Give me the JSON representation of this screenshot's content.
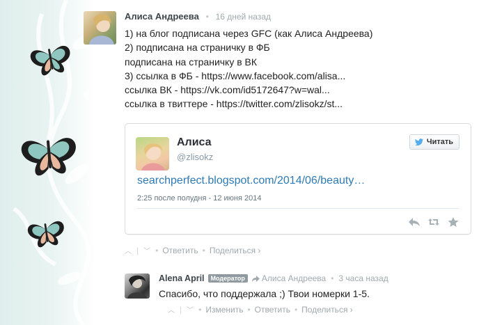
{
  "comments": [
    {
      "author": "Алиса Андреева",
      "time": "16 дней назад",
      "lines": [
        "1) на блог подписана через GFC (как Алиса Андреева)",
        "2) подписана на страничку в ФБ",
        "подписана на страничку в ВК",
        "3) ссылка в ФБ - https://www.facebook.com/alisa...",
        "ссылка ВК - https://vk.com/id5172647?w=wal...",
        "ссылка в твиттере - https://twitter.com/zlisokz/st..."
      ],
      "actions": {
        "reply": "Ответить",
        "share": "Поделиться ›"
      }
    },
    {
      "author": "Alena April",
      "badge": "Модератор",
      "reply_to": "Алиса Андреева",
      "time": "3 часа назад",
      "text": "Спасибо, что поддержала ;) Твои номерки 1-5.",
      "actions": {
        "edit": "Изменить",
        "reply": "Ответить",
        "share": "Поделиться ›"
      }
    }
  ],
  "tweet": {
    "name": "Алиса",
    "handle": "@zlisokz",
    "follow_label": "Читать",
    "link": "searchperfect.blogspot.com/2014/06/beauty…",
    "date": "2:25 после полудня - 12 июня 2014"
  },
  "colors": {
    "link": "#2b7bb9",
    "meta": "#a1a9ac",
    "badge": "#8f9aa0"
  }
}
